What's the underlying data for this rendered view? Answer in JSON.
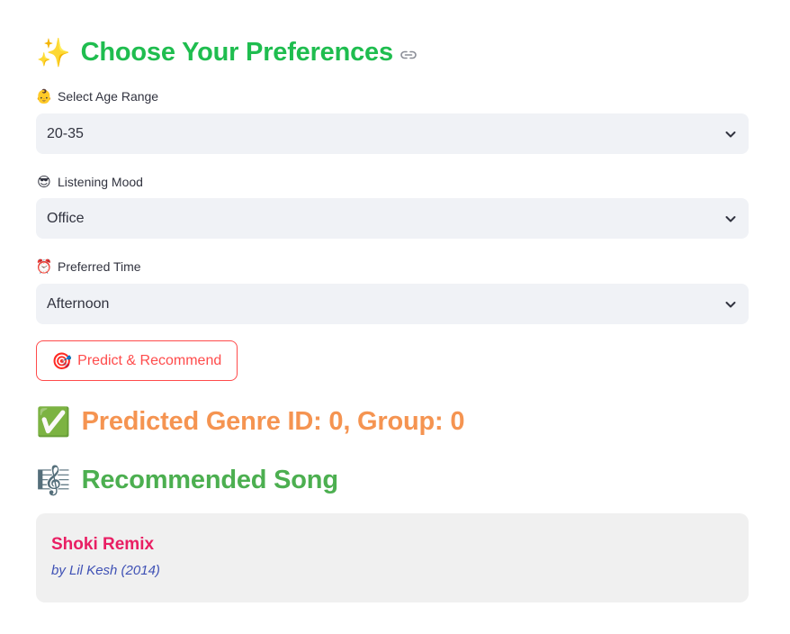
{
  "header": {
    "emoji": "✨",
    "title": "Choose Your Preferences",
    "title_color": "#1fbd4f",
    "link_icon": "link-icon"
  },
  "fields": [
    {
      "emoji": "👶",
      "label": "Select Age Range",
      "value": "20-35"
    },
    {
      "emoji": "😎",
      "label": "Listening Mood",
      "value": "Office"
    },
    {
      "emoji": "⏰",
      "label": "Preferred Time",
      "value": "Afternoon"
    }
  ],
  "button": {
    "emoji": "🎯",
    "label": "Predict & Recommend",
    "color": "#ff4b4b"
  },
  "prediction": {
    "emoji": "✅",
    "text": "Predicted Genre ID: 0, Group: 0",
    "color": "#f59451"
  },
  "recommendation": {
    "emoji": "🎼",
    "heading": "Recommended Song",
    "heading_color": "#4caf50",
    "song_title": "Shoki Remix",
    "song_title_color": "#e91e63",
    "byline": "by Lil Kesh (2014)",
    "byline_color": "#3f51b5"
  }
}
